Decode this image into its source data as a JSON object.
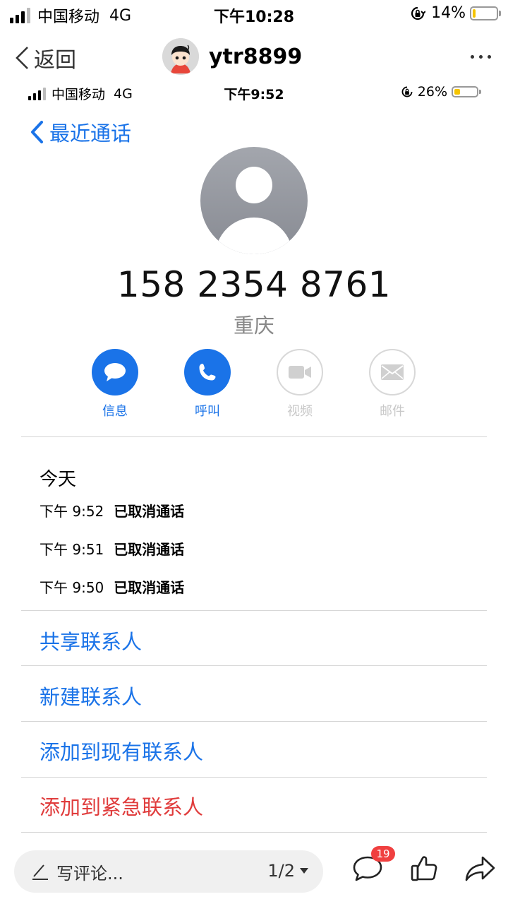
{
  "status_bar": {
    "carrier": "中国移动",
    "network": "4G",
    "time": "下午10:28",
    "battery": "14%",
    "battery_level": 0.14
  },
  "header": {
    "back_label": "返回",
    "username": "ytr8899"
  },
  "screenshot": {
    "status_bar": {
      "carrier": "中国移动",
      "network": "4G",
      "time": "下午9:52",
      "battery": "26%",
      "battery_level": 0.26
    },
    "back_label": "最近通话",
    "phone_number": "158 2354 8761",
    "location": "重庆",
    "actions": [
      {
        "label": "信息",
        "enabled": true,
        "icon": "message-icon"
      },
      {
        "label": "呼叫",
        "enabled": true,
        "icon": "phone-icon"
      },
      {
        "label": "视频",
        "enabled": false,
        "icon": "video-icon"
      },
      {
        "label": "邮件",
        "enabled": false,
        "icon": "mail-icon"
      }
    ],
    "history": {
      "title": "今天",
      "calls": [
        {
          "time": "下午 9:52",
          "status": "已取消通话"
        },
        {
          "time": "下午 9:51",
          "status": "已取消通话"
        },
        {
          "time": "下午 9:50",
          "status": "已取消通话"
        }
      ]
    },
    "menu": [
      {
        "label": "共享联系人"
      },
      {
        "label": "新建联系人"
      },
      {
        "label": "添加到现有联系人"
      },
      {
        "label": "添加到紧急联系人"
      }
    ]
  },
  "bottom_bar": {
    "comment_placeholder": "写评论...",
    "pager": "1/2",
    "comment_count": "19"
  },
  "colors": {
    "accent": "#1a73e8",
    "danger": "#e03c3c",
    "badge": "#f04040",
    "battery": "#f5c400"
  }
}
